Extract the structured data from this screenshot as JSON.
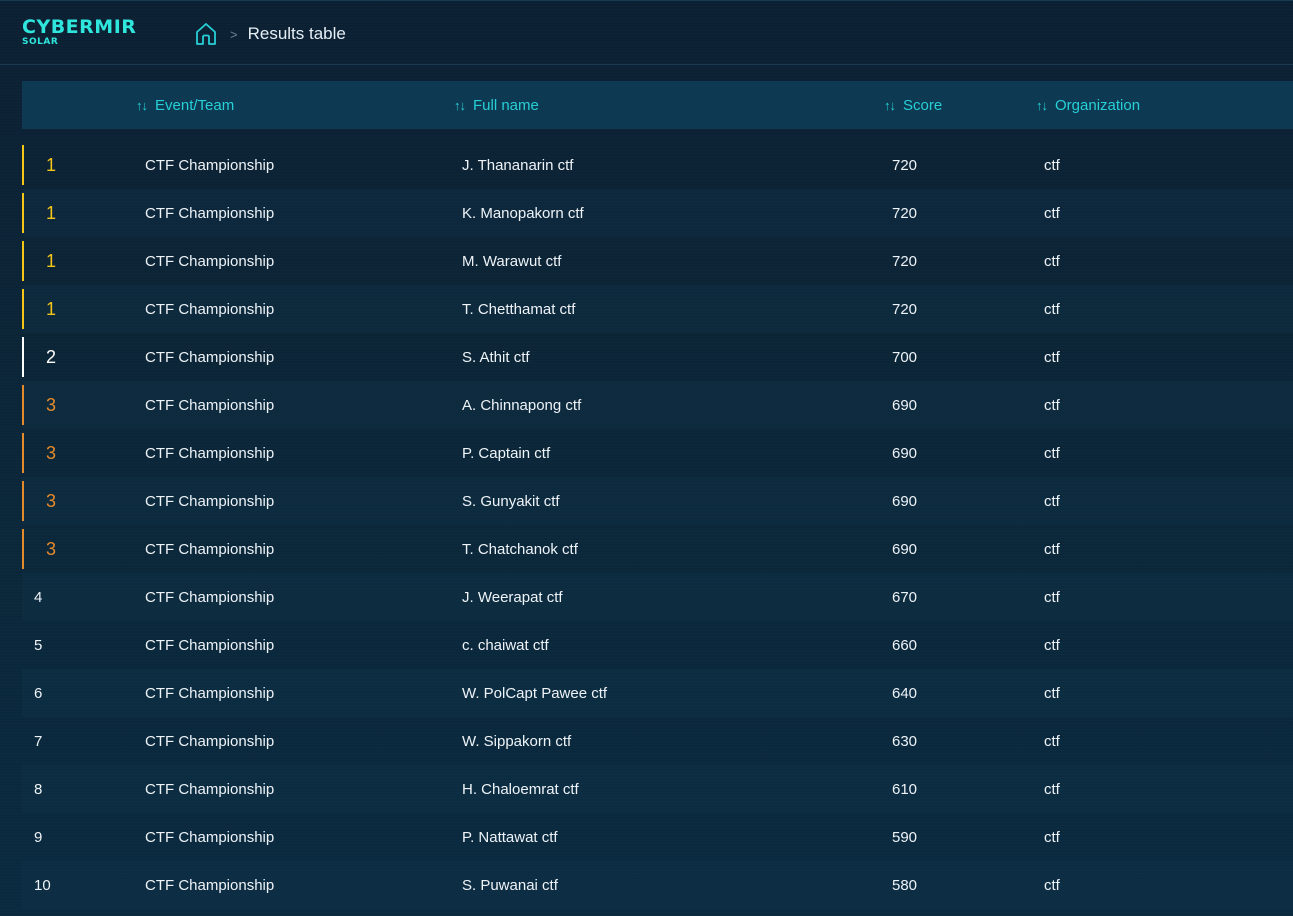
{
  "brand": {
    "name": "CYBERMIR",
    "sub": "SOLAR"
  },
  "breadcrumb": {
    "separator": ">",
    "current": "Results table"
  },
  "columns": [
    {
      "key": "event",
      "label": "Event/Team"
    },
    {
      "key": "name",
      "label": "Full name"
    },
    {
      "key": "score",
      "label": "Score"
    },
    {
      "key": "org",
      "label": "Organization"
    }
  ],
  "colors": {
    "gold": "#f5c518",
    "silver": "#ffffff",
    "bronze": "#e58a2a",
    "accent": "#27cfd6"
  },
  "rows": [
    {
      "rank": "1",
      "event": "CTF Championship",
      "name": "J. Thananarin ctf",
      "score": "720",
      "org": "ctf",
      "medal": "gold"
    },
    {
      "rank": "1",
      "event": "CTF Championship",
      "name": "K. Manopakorn ctf",
      "score": "720",
      "org": "ctf",
      "medal": "gold"
    },
    {
      "rank": "1",
      "event": "CTF Championship",
      "name": "M. Warawut ctf",
      "score": "720",
      "org": "ctf",
      "medal": "gold"
    },
    {
      "rank": "1",
      "event": "CTF Championship",
      "name": "T. Chetthamat ctf",
      "score": "720",
      "org": "ctf",
      "medal": "gold"
    },
    {
      "rank": "2",
      "event": "CTF Championship",
      "name": "S. Athit ctf",
      "score": "700",
      "org": "ctf",
      "medal": "silver"
    },
    {
      "rank": "3",
      "event": "CTF Championship",
      "name": "A. Chinnapong ctf",
      "score": "690",
      "org": "ctf",
      "medal": "bronze"
    },
    {
      "rank": "3",
      "event": "CTF Championship",
      "name": "P. Captain ctf",
      "score": "690",
      "org": "ctf",
      "medal": "bronze"
    },
    {
      "rank": "3",
      "event": "CTF Championship",
      "name": "S. Gunyakit ctf",
      "score": "690",
      "org": "ctf",
      "medal": "bronze"
    },
    {
      "rank": "3",
      "event": "CTF Championship",
      "name": "T. Chatchanok ctf",
      "score": "690",
      "org": "ctf",
      "medal": "bronze"
    },
    {
      "rank": "4",
      "event": "CTF Championship",
      "name": "J. Weerapat ctf",
      "score": "670",
      "org": "ctf",
      "medal": ""
    },
    {
      "rank": "5",
      "event": "CTF Championship",
      "name": "c. chaiwat ctf",
      "score": "660",
      "org": "ctf",
      "medal": ""
    },
    {
      "rank": "6",
      "event": "CTF Championship",
      "name": "W. PolCapt Pawee ctf",
      "score": "640",
      "org": "ctf",
      "medal": ""
    },
    {
      "rank": "7",
      "event": "CTF Championship",
      "name": "W. Sippakorn ctf",
      "score": "630",
      "org": "ctf",
      "medal": ""
    },
    {
      "rank": "8",
      "event": "CTF Championship",
      "name": "H. Chaloemrat ctf",
      "score": "610",
      "org": "ctf",
      "medal": ""
    },
    {
      "rank": "9",
      "event": "CTF Championship",
      "name": "P. Nattawat ctf",
      "score": "590",
      "org": "ctf",
      "medal": ""
    },
    {
      "rank": "10",
      "event": "CTF Championship",
      "name": "S. Puwanai ctf",
      "score": "580",
      "org": "ctf",
      "medal": ""
    }
  ]
}
